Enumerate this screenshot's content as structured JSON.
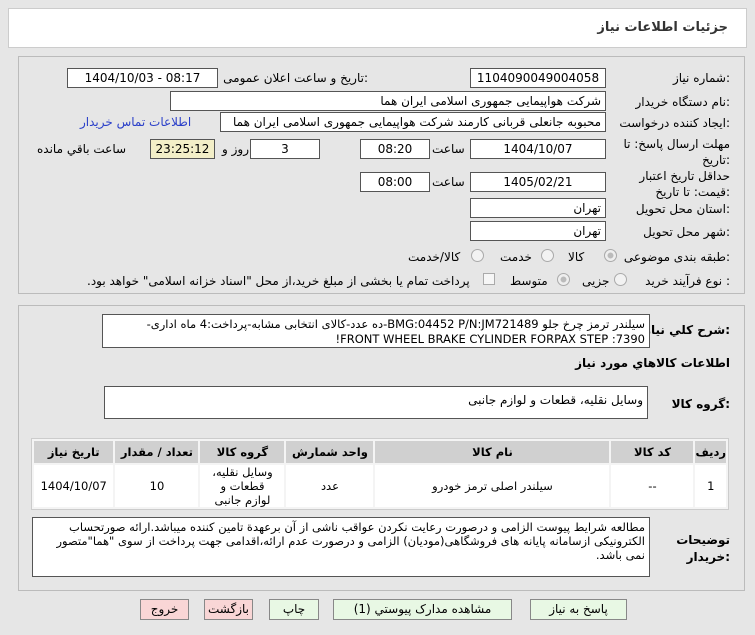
{
  "header": {
    "title": "جزئیات اطلاعات نیاز"
  },
  "form": {
    "need_number_label": "شماره نیاز:",
    "need_number": "1104090049004058",
    "announce_label": "تاریخ و ساعت اعلان عمومی:",
    "announce_value": "1404/10/03 - 08:17",
    "buyer_label": "نام دستگاه خریدار:",
    "buyer": "شرکت هواپیمایی جمهوری اسلامی ایران هما",
    "creator_label": "ایجاد کننده درخواست:",
    "creator": "محبوبه جانعلی قربانی کارمند شرکت هواپیمایی جمهوری اسلامی ایران هما",
    "contact_link": "اطلاعات تماس خریدار",
    "deadline_label": "مهلت ارسال پاسخ: تا تاریخ:",
    "deadline_date": "1404/10/07",
    "time_label": "ساعت",
    "deadline_time": "08:20",
    "days": "3",
    "days_label": "روز و",
    "remaining": "23:25:12",
    "remaining_label": "ساعت باقي مانده",
    "validity_label": "حداقل تاریخ اعتبار قیمت: تا تاریخ:",
    "validity_date": "1405/02/21",
    "validity_time": "08:00",
    "province_label": "استان محل تحویل:",
    "province": "تهران",
    "city_label": "شهر محل تحویل:",
    "city": "تهران",
    "category_label": "طبقه بندی موضوعی:",
    "category_options": [
      "کالا",
      "خدمت",
      "کالا/خدمت"
    ],
    "category_selected": "کالا",
    "process_label": "نوع فرآیند خرید :",
    "process_options": [
      "جزیی",
      "متوسط"
    ],
    "process_selected": "جزیی",
    "payment_note": "پرداخت تمام یا بخشی از مبلغ خرید،از محل \"اسناد خزانه اسلامی\" خواهد بود."
  },
  "details": {
    "desc_label": "شرح کلي نياز:",
    "desc": "سیلندر ترمز چرخ جلو BMG:04452 P/N:JM721489-ده عدد-کالای انتخابی مشابه-پرداخت:4 ماه اداری- FRONT WHEEL BRAKE CYLINDER FORPAX STEP :7390!",
    "goods_heading": "اطلاعات کالاهاي مورد نياز",
    "group_label": "گروه کالا:",
    "group": "وسایل نقلیه، قطعات و لوازم جانبی",
    "table": {
      "headers": [
        "ردیف",
        "کد کالا",
        "نام کالا",
        "واحد شمارش",
        "گروه کالا",
        "تعداد / مقدار",
        "تاریخ نیاز"
      ],
      "rows": [
        [
          "1",
          "--",
          "سیلندر اصلی ترمز خودرو",
          "عدد",
          "وسایل نقلیه، قطعات و لوازم جانبی",
          "10",
          "1404/10/07"
        ]
      ]
    },
    "notes_label": "توضیحات خریدار:",
    "notes": "مطالعه شرایط پیوست الزامی و درصورت رعایت نکردن عواقب ناشی از آن برعهدة تامین کننده میباشد.ارائه صورتحساب الکترونیکی ازسامانه پایانه های فروشگاهی(مودیان) الزامی و درصورت عدم ارائه،اقدامی جهت پرداخت از سوی \"هما\"متصور نمی باشد."
  },
  "buttons": {
    "reply": "پاسخ به نیاز",
    "attachments": "مشاهده مدارک پیوستي (1)",
    "print": "چاپ",
    "back": "بازگشت",
    "exit": "خروج"
  }
}
